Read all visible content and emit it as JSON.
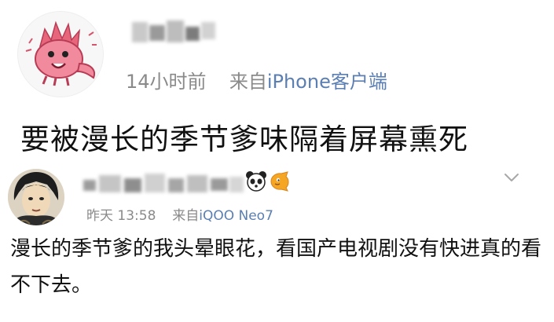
{
  "post": {
    "time": "14小时前",
    "source_prefix": "来自",
    "source": "iPhone客户端",
    "text": "要被漫长的季节爹味隔着屏幕熏死"
  },
  "comment": {
    "time": "昨天 13:58",
    "source_prefix": "来自",
    "source": "iQOO Neo7",
    "text": "漫长的季节爹的我头晕眼花，看国产电视剧没有快进真的看不下去。"
  },
  "icons": {
    "emoji_1": "panda-emoji-icon",
    "emoji_2": "fish-emoji-icon",
    "expand": "chevron-down-icon"
  },
  "colors": {
    "meta_gray": "#8a8a8a",
    "source_blue": "#5b7fb2",
    "text": "#111111"
  }
}
